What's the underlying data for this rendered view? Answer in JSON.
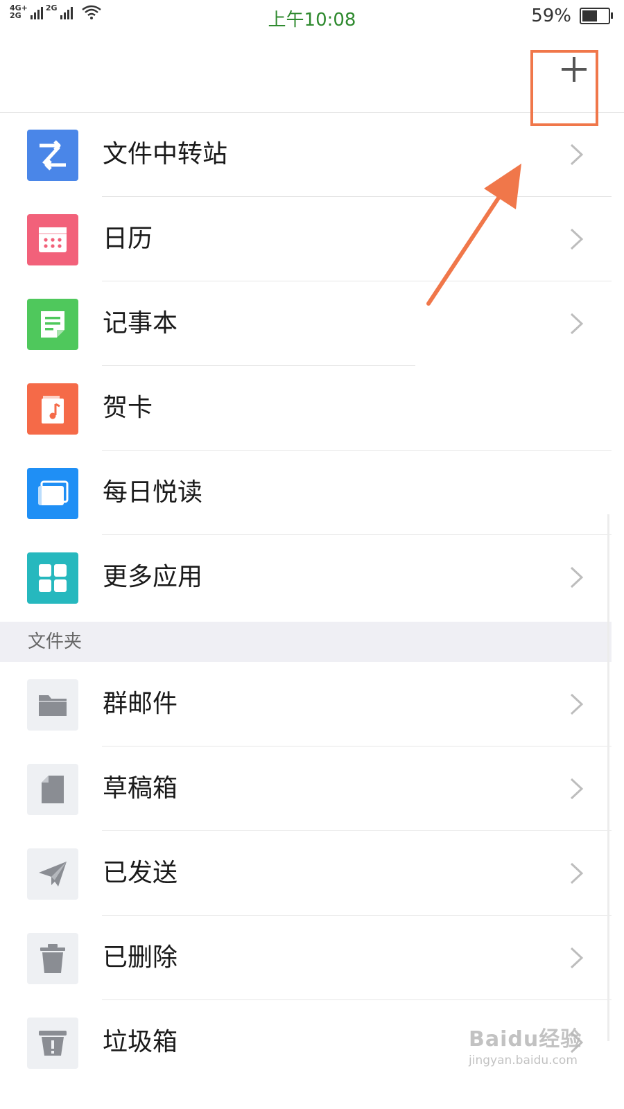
{
  "status_bar": {
    "network_label": "4G+\n2G",
    "network2_label": "2G",
    "time": "上午10:08",
    "battery_percent_text": "59%",
    "battery_level": 0.59
  },
  "header": {
    "add_icon": "plus-icon"
  },
  "apps": [
    {
      "label": "文件中转站",
      "icon": "transfer-icon",
      "color": "#4a86e8",
      "has_chevron": true
    },
    {
      "label": "日历",
      "icon": "calendar-icon",
      "color": "#f2617a",
      "has_chevron": true
    },
    {
      "label": "记事本",
      "icon": "notepad-icon",
      "color": "#4fc85c",
      "has_chevron": true
    },
    {
      "label": "贺卡",
      "icon": "greeting-card-icon",
      "color": "#f56a48",
      "has_chevron": false
    },
    {
      "label": "每日悦读",
      "icon": "daily-read-icon",
      "color": "#1f8ff5",
      "has_chevron": false
    },
    {
      "label": "更多应用",
      "icon": "grid-icon",
      "color": "#26b8be",
      "has_chevron": true
    }
  ],
  "folders_section": {
    "title": "文件夹",
    "items": [
      {
        "label": "群邮件",
        "icon": "folder-icon"
      },
      {
        "label": "草稿箱",
        "icon": "draft-icon"
      },
      {
        "label": "已发送",
        "icon": "send-icon"
      },
      {
        "label": "已删除",
        "icon": "trash-icon"
      },
      {
        "label": "垃圾箱",
        "icon": "spam-icon"
      }
    ]
  },
  "colors": {
    "annotation": "#f0774a",
    "folder_icon_bg": "#eef0f3",
    "folder_glyph": "#8a8d93"
  },
  "watermark": {
    "main": "Baidu经验",
    "sub": "jingyan.baidu.com"
  }
}
